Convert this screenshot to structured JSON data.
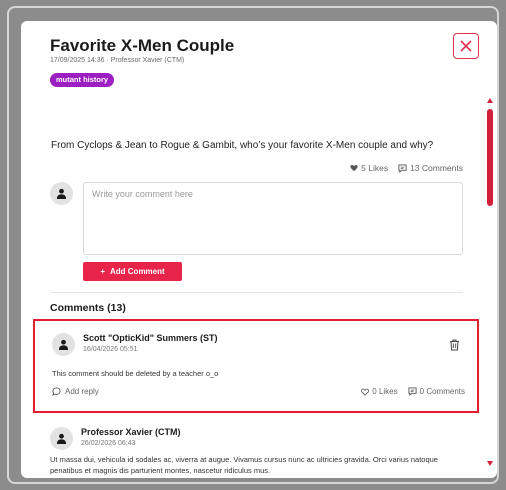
{
  "post": {
    "title": "Favorite X-Men Couple",
    "meta": "17/09/2025 14:36 · Professor Xavier (CTM)",
    "tag": "mutant history",
    "question": "From Cyclops & Jean to Rogue & Gambit, who’s your favorite X-Men couple and why?",
    "likes": "5 Likes",
    "comments_count": "13 Comments"
  },
  "composer": {
    "placeholder": "Write your comment here",
    "button_label": "Add Comment",
    "button_icon": "+"
  },
  "comments_section": {
    "heading": "Comments (13)",
    "items": [
      {
        "author": "Scott \"OpticKid\" Summers (ST)",
        "date": "16/04/2026 05:51",
        "body": "This comment should be deleted by a teacher o_o",
        "reply_label": "Add reply",
        "likes": "0 Likes",
        "comments": "0 Comments"
      },
      {
        "author": "Professor Xavier (CTM)",
        "date": "26/02/2026 06:43",
        "body": "Ut massa dui, vehicula id sodales ac, viverra at augue. Vivamus cursus nunc ac ultricies gravida. Orci varius natoque penatibus et magnis dis parturient montes, nascetur ridiculus mus."
      }
    ]
  },
  "colors": {
    "accent": "#e8244a",
    "tag": "#9b1fc1",
    "highlight_border": "#e11d2f"
  }
}
